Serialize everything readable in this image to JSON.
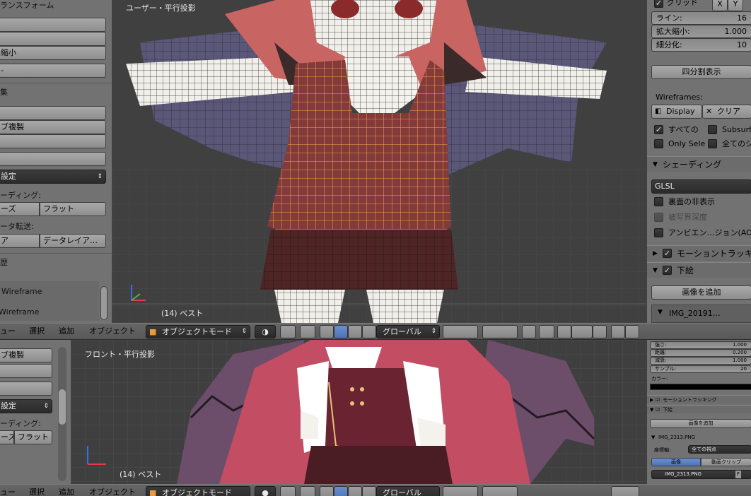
{
  "top_shelf": {
    "transform_header": "ランスフォーム",
    "button_scale": "縮小",
    "section2_header": "集",
    "button_duplicate": "ブ複製",
    "dropdown_shading_setting": "設定",
    "shading_label": "ーディング:",
    "smooth_button": "ーズ",
    "flat_button": "フラット",
    "transfer_label": "ータ転送:",
    "data_button_left": "ア",
    "data_layout_button": "データレイア…",
    "history_header": "歴",
    "wireframe_item_1": "Wireframe",
    "wireframe_item_2": "Wireframe"
  },
  "top_viewport": {
    "label": "ユーザー・平行投影",
    "object_info": "(14) ベスト"
  },
  "top_header": {
    "view_menu": "ュー",
    "select_menu": "選択",
    "add_menu": "追加",
    "object_menu": "オブジェクト",
    "mode_dropdown": "オブジェクトモード",
    "orientation_dropdown": "グローバル"
  },
  "right_panel": {
    "grid_label": "グリッド",
    "axis_x": "X",
    "axis_y": "Y",
    "lines_label": "ライン:",
    "lines_value": "16",
    "scale_label": "拡大縮小:",
    "scale_value": "1.000",
    "subdiv_label": "細分化:",
    "subdiv_value": "10",
    "quad_view_button": "四分割表示",
    "wireframes_label": "Wireframes:",
    "display_button": "Display",
    "clear_button": "クリア",
    "all_label": "すべての",
    "subsurf_label": "Subsurf C",
    "only_sel_label": "Only Sele",
    "all_sh_label": "全てのシ",
    "shading_header": "シェーディング",
    "glsl_dropdown": "GLSL",
    "backface_label": "裏面の非表示",
    "dof_label": "被写界深度",
    "ao_label": "アンビエン…ジョン(AO)",
    "motion_tracking_header": "モーショントラッキ",
    "background_header": "下絵",
    "add_image_button": "画像を追加",
    "image_item": "IMG_20191…"
  },
  "bottom_shelf": {
    "button_duplicate": "ブ複製",
    "dropdown_shading_setting": "設定",
    "shading_label": "ーディング:",
    "smooth_button": "ーズ",
    "flat_button": "フラット"
  },
  "bottom_viewport": {
    "label": "フロント・平行投影",
    "object_info": "(14) ベスト"
  },
  "bottom_right_panel": {
    "strength_label": "強さ:",
    "strength_value": "1.000",
    "distance_label": "距離:",
    "distance_value": "0.200",
    "attenuation_label": "減衰:",
    "attenuation_value": "1.000",
    "samples_label": "サンプル:",
    "samples_value": "20",
    "color_label": "カラー:",
    "motion_tracking_header": "モーショントラッキング",
    "background_header": "下絵",
    "add_image_button": "画像を追加",
    "image_name": "IMG_2313.PNG",
    "axis_label": "座標軸:",
    "axis_dropdown": "全ての視点",
    "tab_image": "画像",
    "tab_movie_clip": "動画クリップ",
    "image_field": "IMG_2313.PNG",
    "image_field_flag": "F"
  },
  "bottom_header": {
    "view_menu": "ュー",
    "select_menu": "選択",
    "add_menu": "追加",
    "object_menu": "オブジェクト",
    "mode_dropdown": "オブジェクトモード",
    "orientation_dropdown": "グローバル"
  },
  "colors": {
    "viewport_bg": "#3d3d3d",
    "panel_bg": "#727272",
    "selection_orange": "#ffa030",
    "vest_red": "#7a3030",
    "wing_purple": "#5a4f78",
    "accent_blue": "#5b82c8"
  }
}
